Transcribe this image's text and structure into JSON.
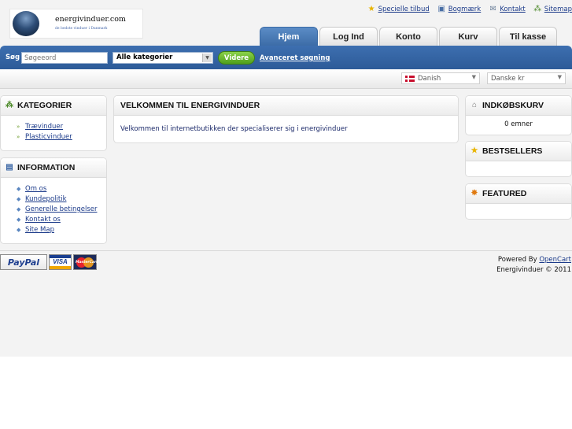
{
  "logo": {
    "name": "energivinduer.com",
    "slogan": "de bedste vinduer i Danmark"
  },
  "top_links": [
    {
      "label": "Specielle tilbud",
      "icon": "star-icon"
    },
    {
      "label": "Bogmærk",
      "icon": "bookmark-icon"
    },
    {
      "label": "Kontakt",
      "icon": "mail-icon"
    },
    {
      "label": "Sitemap",
      "icon": "sitemap-icon"
    }
  ],
  "tabs": [
    {
      "label": "Hjem",
      "active": true
    },
    {
      "label": "Log Ind"
    },
    {
      "label": "Konto"
    },
    {
      "label": "Kurv"
    },
    {
      "label": "Til kasse"
    }
  ],
  "search": {
    "label": "Søg",
    "placeholder": "Søgeeord",
    "category": "Alle kategorier",
    "button": "Videre",
    "advanced": "Avanceret søgning"
  },
  "language": "Danish",
  "currency": "Danske kr",
  "categories": {
    "title": "KATEGORIER",
    "items": [
      "Trævinduer",
      "Plasticvinduer"
    ]
  },
  "information": {
    "title": "INFORMATION",
    "items": [
      "Om os",
      "Kundepolitik",
      "Generelle betingelser",
      "Kontakt os",
      "Site Map"
    ]
  },
  "main": {
    "title": "VELKOMMEN TIL ENERGIVINDUER",
    "text": "Velkommen til internetbutikken der specialiserer sig i energivinduer"
  },
  "cart": {
    "title": "INDKØBSKURV",
    "text": "0 emner"
  },
  "bestsellers": {
    "title": "BESTSELLERS"
  },
  "featured": {
    "title": "FEATURED"
  },
  "footer": {
    "powered_prefix": "Powered By",
    "powered_link": "OpenCart",
    "copyright": "Energivinduer © 2011",
    "payment": {
      "paypal": "PayPal",
      "visa": "VISA",
      "mastercard": "MasterCard"
    }
  },
  "colors": {
    "nav_blue": "#3d6fb0",
    "button_green": "#5fae26",
    "link": "#1c3b8a"
  }
}
